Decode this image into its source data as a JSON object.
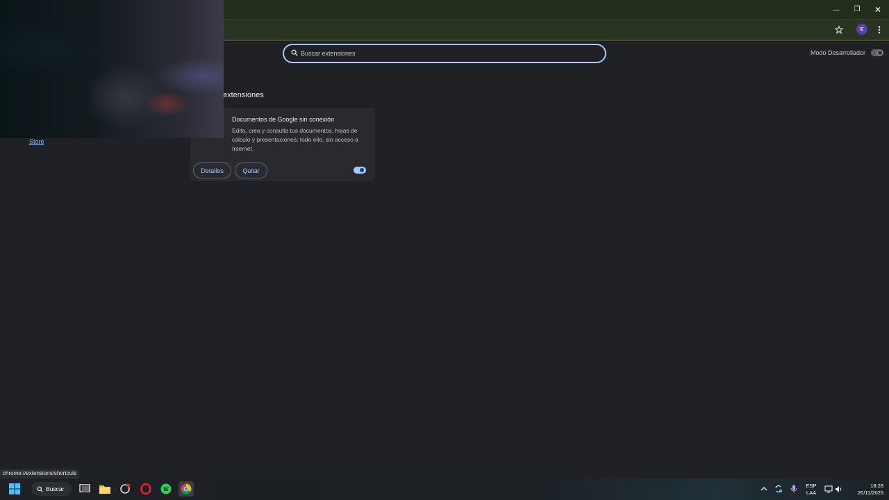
{
  "window": {
    "minimize": "—",
    "maximize": "❐",
    "close": "✕"
  },
  "toolbar": {
    "avatar_letter": "E"
  },
  "search": {
    "placeholder": "Buscar extensiones"
  },
  "dev_mode": {
    "label": "Modo Desarrollador",
    "enabled": false
  },
  "section": {
    "title": "extensiones"
  },
  "sidebar": {
    "store_link": "Store"
  },
  "extension": {
    "name": "Documentos de Google sin conexión",
    "description": "Edita, crea y consulta tus documentos, hojas de cálculo y presentaciones; todo ello, sin acceso a Internet.",
    "details_label": "Detalles",
    "remove_label": "Quitar",
    "enabled": true
  },
  "status_url": "chrome://extensions/shortcuts",
  "taskbar": {
    "search_label": "Buscar",
    "lang_line1": "ESP",
    "lang_line2": "LAA",
    "time": "18:28",
    "date": "20/11/2025"
  },
  "colors": {
    "accent": "#a8c7fa",
    "link": "#8ab4f8",
    "background": "#202124"
  }
}
